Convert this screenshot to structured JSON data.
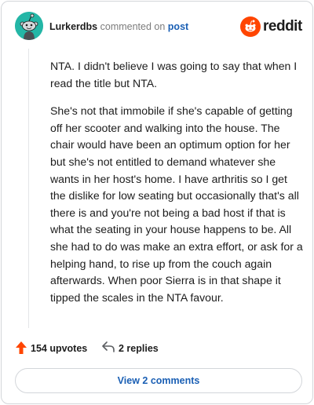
{
  "header": {
    "username": "Lurkerdbs",
    "action_text": "commented on",
    "post_link": "post",
    "brand_name": "reddit",
    "brand_color": "#ff4500",
    "avatar_color": "#24b6a6"
  },
  "comment": {
    "paragraphs": [
      "NTA. I didn't believe I was going to say that when I read the title but NTA.",
      "She's not that immobile if she's capable of getting off her scooter and walking into the house. The chair would have been an optimum option for her but she's not entitled to demand whatever she wants in her host's home. I have arthritis so I get the dislike for low seating but occasionally that's all there is and you're not being a bad host if that is what the seating in your house happens to be. All she had to do was make an extra effort, or ask for a helping hand, to rise up from the couch again afterwards. When poor Sierra is in that shape it tipped the scales in the NTA favour."
    ]
  },
  "actions": {
    "upvotes_label": "154 upvotes",
    "replies_label": "2 replies",
    "upvote_icon": "upvote-arrow-icon",
    "reply_icon": "reply-arrow-icon"
  },
  "footer": {
    "view_comments_label": "View 2 comments"
  }
}
